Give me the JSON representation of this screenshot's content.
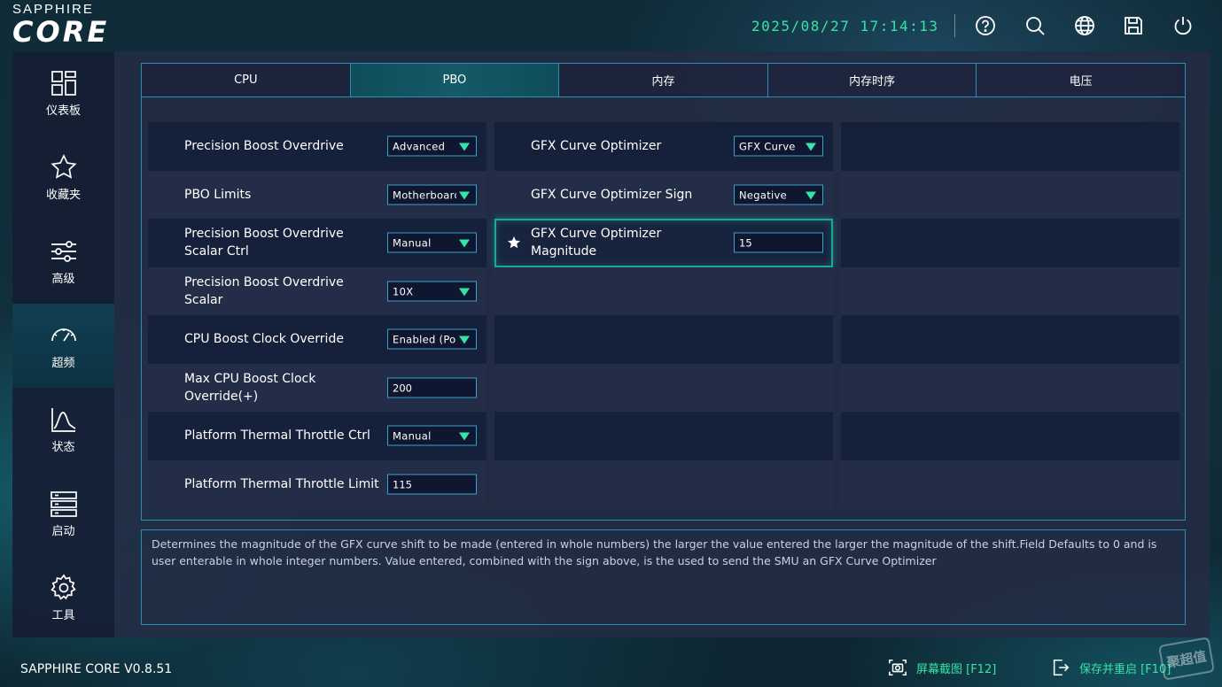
{
  "brand": {
    "top": "SAPPHIRE",
    "main": "CORE"
  },
  "header": {
    "datetime": "2025/08/27  17:14:13",
    "icons": [
      "help-icon",
      "search-icon",
      "globe-icon",
      "save-icon",
      "power-icon"
    ]
  },
  "sidebar": {
    "items": [
      {
        "label": "仪表板",
        "icon": "dashboard-icon",
        "active": false
      },
      {
        "label": "收藏夹",
        "icon": "star-icon",
        "active": false
      },
      {
        "label": "高级",
        "icon": "sliders-icon",
        "active": false
      },
      {
        "label": "超频",
        "icon": "gauge-icon",
        "active": true
      },
      {
        "label": "状态",
        "icon": "chart-icon",
        "active": false
      },
      {
        "label": "启动",
        "icon": "server-icon",
        "active": false
      },
      {
        "label": "工具",
        "icon": "gear-icon",
        "active": false
      }
    ]
  },
  "tabs": [
    {
      "label": "CPU",
      "active": false
    },
    {
      "label": "PBO",
      "active": true
    },
    {
      "label": "内存",
      "active": false
    },
    {
      "label": "内存时序",
      "active": false
    },
    {
      "label": "电压",
      "active": false
    }
  ],
  "settings_left": [
    {
      "label": "Precision Boost Overdrive",
      "type": "select",
      "value": "Advanced"
    },
    {
      "label": "PBO Limits",
      "type": "select",
      "value": "Motherboard"
    },
    {
      "label": "Precision Boost Overdrive Scalar Ctrl",
      "type": "select",
      "value": "Manual"
    },
    {
      "label": "Precision Boost Overdrive Scalar",
      "type": "select",
      "value": "10X"
    },
    {
      "label": "CPU Boost Clock Override",
      "type": "select",
      "value": "Enabled (Positive)"
    },
    {
      "label": "Max CPU Boost Clock Override(+)",
      "type": "input",
      "value": "200"
    },
    {
      "label": "Platform Thermal Throttle Ctrl",
      "type": "select",
      "value": "Manual"
    },
    {
      "label": "Platform Thermal Throttle Limit",
      "type": "input",
      "value": "115"
    }
  ],
  "settings_middle": [
    {
      "label": "GFX Curve Optimizer",
      "type": "select",
      "value": "GFX Curve"
    },
    {
      "label": "GFX Curve Optimizer Sign",
      "type": "select",
      "value": "Negative"
    },
    {
      "label": "GFX Curve Optimizer Magnitude",
      "type": "input",
      "value": "15",
      "selected": true,
      "starred": true
    }
  ],
  "help_text": "Determines the magnitude of the GFX curve shift to be made (entered in whole numbers) the larger the value entered the larger the magnitude of the shift.Field Defaults to 0 and is user enterable in whole integer numbers. Value entered, combined with the sign above, is the used to send the SMU an GFX Curve Optimizer",
  "footer": {
    "version": "SAPPHIRE CORE V0.8.51",
    "screenshot_label": "屏幕截图 [F12]",
    "save_restart_label": "保存并重启 [F10]"
  },
  "watermark": "聚超值",
  "colors": {
    "accent": "#33e5a6",
    "border": "#2a8fb0",
    "panel": "#242d47",
    "row_dark": "#15203a"
  }
}
